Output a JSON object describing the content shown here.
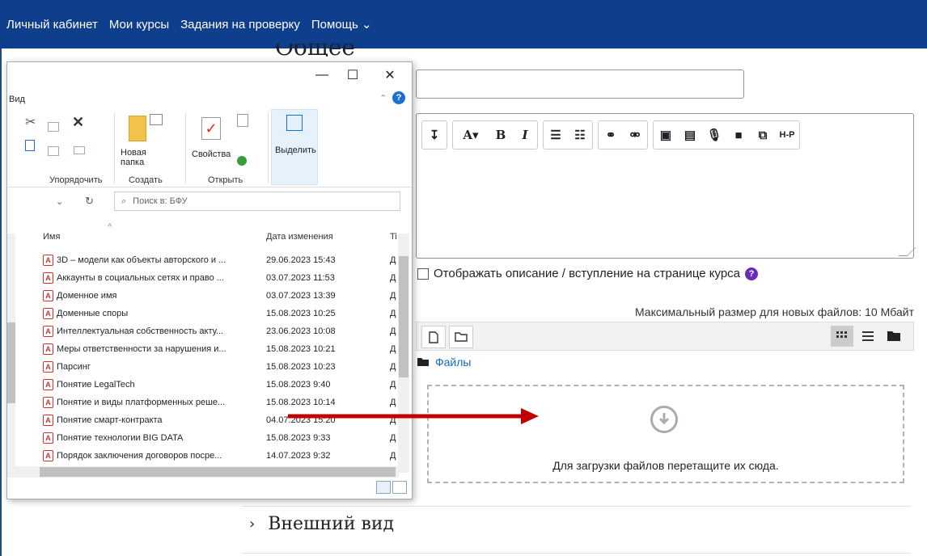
{
  "navbar": {
    "items": [
      "Личный кабинет",
      "Мои курсы",
      "Задания на проверку",
      "Помощь ⌄"
    ]
  },
  "section_title_partial": "Общее",
  "show_description_label": "Отображать описание / вступление на странице курса",
  "max_size_label": "Максимальный размер для новых файлов: 10 Мбайт",
  "filepicker": {
    "path_label": "Файлы",
    "dropzone_text": "Для загрузки файлов перетащите их сюда."
  },
  "appearance_label": "Внешний вид",
  "explorer": {
    "tab_view": "Вид",
    "ribbon": {
      "new_folder": "Новая папка",
      "properties": "Свойства",
      "select": "Выделить",
      "group_organize": "Упорядочить",
      "group_create": "Создать",
      "group_open": "Открыть"
    },
    "search_placeholder": "Поиск в: БФУ",
    "col_name": "Имя",
    "col_date": "Дата изменения",
    "col_type": "Ti",
    "files": [
      {
        "name": "3D – модели как объекты авторского и ...",
        "date": "29.06.2023 15:43",
        "type": "Д"
      },
      {
        "name": "Аккаунты в социальных сетях и право ...",
        "date": "03.07.2023 11:53",
        "type": "Д"
      },
      {
        "name": "Доменное имя",
        "date": "03.07.2023 13:39",
        "type": "Д"
      },
      {
        "name": "Доменные споры",
        "date": "15.08.2023 10:25",
        "type": "Д"
      },
      {
        "name": "Интеллектуальная собственность акту...",
        "date": "23.06.2023 10:08",
        "type": "Д"
      },
      {
        "name": "Меры ответственности за нарушения и...",
        "date": "15.08.2023 10:21",
        "type": "Д"
      },
      {
        "name": "Парсинг",
        "date": "15.08.2023 10:23",
        "type": "Д"
      },
      {
        "name": "Понятие LegalTech",
        "date": "15.08.2023 9:40",
        "type": "Д"
      },
      {
        "name": "Понятие и виды платформенных реше...",
        "date": "15.08.2023 10:14",
        "type": "Д"
      },
      {
        "name": "Понятие смарт-контракта",
        "date": "04.07.2023 15:20",
        "type": "Д"
      },
      {
        "name": "Понятие технологии BIG DATA",
        "date": "15.08.2023 9:33",
        "type": "Д"
      },
      {
        "name": "Порядок заключения договоров посре...",
        "date": "14.07.2023 9:32",
        "type": "Д"
      }
    ]
  },
  "colors": {
    "navbar": "#0f3e8c",
    "arrow": "#c00000",
    "link": "#0f6cbf",
    "help": "#6a2bb8"
  }
}
